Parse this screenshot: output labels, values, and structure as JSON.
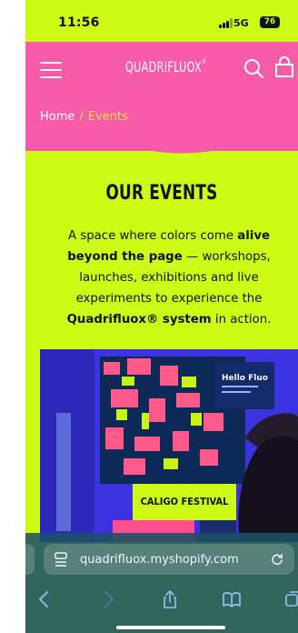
{
  "status_bar": {
    "time": "11:56",
    "network": "5G",
    "battery": "76"
  },
  "header": {
    "logo": "QUADRIFLUOX",
    "logo_mark": "®",
    "menu_icon": "hamburger-menu-icon",
    "search_icon": "search-icon",
    "bag_icon": "shopping-bag-icon"
  },
  "breadcrumb": {
    "home": "Home",
    "separator": "/",
    "current": "Events"
  },
  "hero": {
    "title": "OUR EVENTS",
    "desc_1": "A space where colors come ",
    "desc_2": "alive beyond the page",
    "desc_3": " — workshops, launches, exhibitions and live experiments to experience the ",
    "desc_4": "Quadrifluox® system",
    "desc_5": " in action."
  },
  "event_card": {
    "button_label": "CALIGO FESTIVAL",
    "poster_text": "Hello Fluo"
  },
  "browser": {
    "url": "quadrifluox.myshopify.com",
    "back_icon": "chevron-left-icon",
    "forward_icon": "chevron-right-icon",
    "share_icon": "share-icon",
    "bookmarks_icon": "book-icon",
    "tabs_icon": "tabs-icon",
    "reload_icon": "reload-icon"
  },
  "colors": {
    "lime": "#cdfb16",
    "pink": "#f65ba9",
    "breadcrumb_current": "#ffe04d",
    "card_blue": "#3a2fd9"
  }
}
